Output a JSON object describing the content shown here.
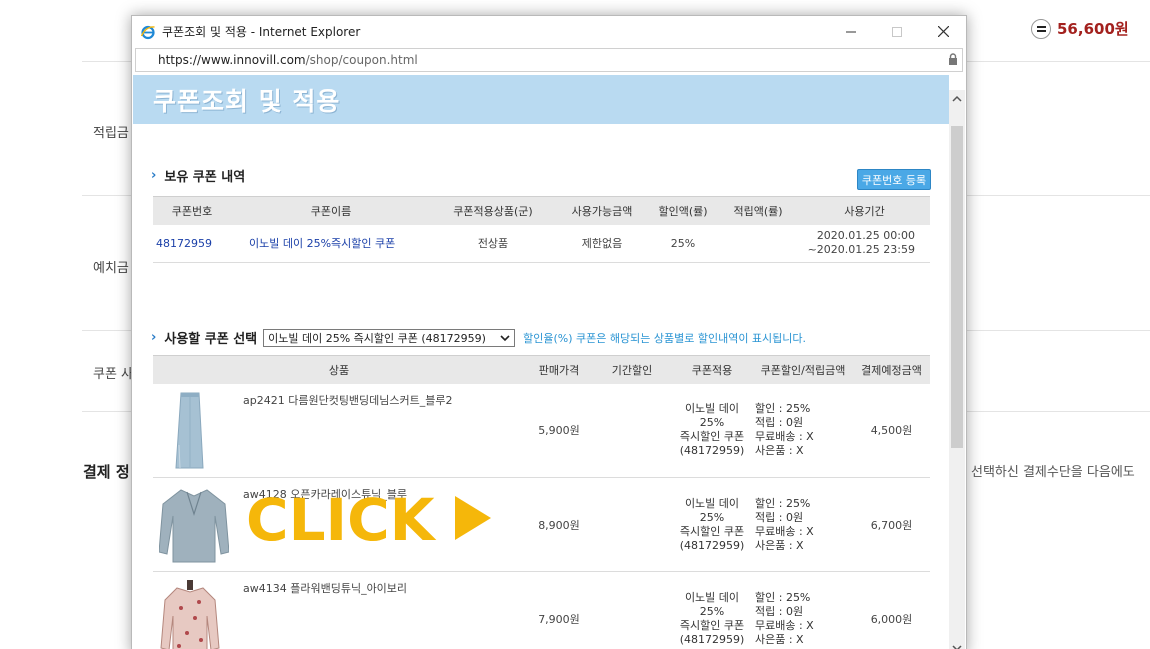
{
  "background": {
    "total_amount": "56,600원",
    "labels": [
      "적립금",
      "예치금",
      "쿠폰 사"
    ],
    "payment_title": "결제 정",
    "payment_desc": "선택하신 결제수단을 다음에도"
  },
  "window": {
    "title": "쿠폰조회 및 적용 - Internet Explorer",
    "url_host": "https://www.innovill.com",
    "url_path": "/shop/coupon.html"
  },
  "banner": {
    "title": "쿠폰조회 및 적용"
  },
  "owned": {
    "section_title": "보유 쿠폰 내역",
    "register_button": "쿠폰번호 등록",
    "headers": [
      "쿠폰번호",
      "쿠폰이름",
      "쿠폰적용상품(군)",
      "사용가능금액",
      "할인액(률)",
      "적립액(률)",
      "사용기간"
    ],
    "rows": [
      {
        "number": "48172959",
        "name": "이노빌 데이 25%즉시할인 쿠폰",
        "target": "전상품",
        "min_amount": "제한없음",
        "discount": "25%",
        "reserve": "",
        "period_start": "2020.01.25 00:00",
        "period_end": "~2020.01.25 23:59"
      }
    ]
  },
  "select": {
    "section_title": "사용할 쿠폰 선택",
    "selected": "이노빌 데이 25% 즉시할인 쿠폰 (48172959)",
    "note": "할인율(%) 쿠폰은 해당되는 상품별로 할인내역이 표시됩니다.",
    "headers": [
      "상품",
      "판매가격",
      "기간할인",
      "쿠폰적용",
      "쿠폰할인/적립금액",
      "결제예정금액"
    ],
    "products": [
      {
        "name": "ap2421 다름원단컷팅밴딩데님스커트_블루2",
        "image": "denim-skirt",
        "price": "5,900원",
        "period_discount": "",
        "coupon_line1": "이노빌 데이 25%",
        "coupon_line2": "즉시할인 쿠폰",
        "coupon_line3": "(48172959)",
        "d_discount": "할인 : 25%",
        "d_reserve": "적립 : 0원",
        "d_shipping": "무료배송 : X",
        "d_gift": "사은품 : X",
        "final": "4,500원"
      },
      {
        "name": "aw4128 오픈카라레이스튜닉_블루",
        "image": "blue-blouse",
        "price": "8,900원",
        "period_discount": "",
        "coupon_line1": "이노빌 데이 25%",
        "coupon_line2": "즉시할인 쿠폰",
        "coupon_line3": "(48172959)",
        "d_discount": "할인 : 25%",
        "d_reserve": "적립 : 0원",
        "d_shipping": "무료배송 : X",
        "d_gift": "사은품 : X",
        "final": "6,700원"
      },
      {
        "name": "aw4134 플라워밴딩튜닉_아이보리",
        "image": "floral-blouse",
        "price": "7,900원",
        "period_discount": "",
        "coupon_line1": "이노빌 데이 25%",
        "coupon_line2": "즉시할인 쿠폰",
        "coupon_line3": "(48172959)",
        "d_discount": "할인 : 25%",
        "d_reserve": "적립 : 0원",
        "d_shipping": "무료배송 : X",
        "d_gift": "사은품 : X",
        "final": "6,000원"
      }
    ]
  },
  "overlay": {
    "click_text": "CLICK"
  },
  "colors": {
    "banner": "#b9daf1",
    "accent_blue": "#2a94d3",
    "total_red": "#a3211e",
    "click_yellow": "#f5b70a"
  }
}
